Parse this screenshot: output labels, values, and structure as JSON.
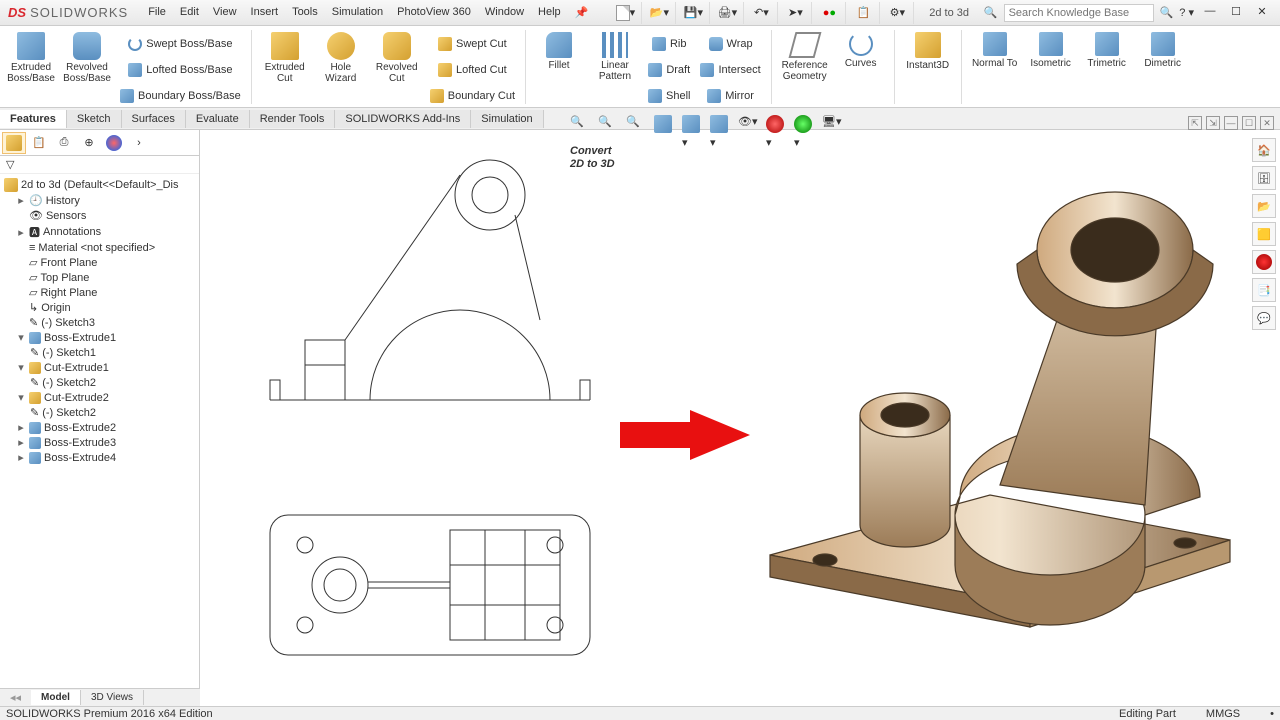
{
  "app": {
    "logo_ds": "DS",
    "logo_text": "SOLIDWORKS",
    "doc_title": "2d to 3d"
  },
  "menus": [
    "File",
    "Edit",
    "View",
    "Insert",
    "Tools",
    "Simulation",
    "PhotoView 360",
    "Window",
    "Help"
  ],
  "search_placeholder": "Search Knowledge Base",
  "ribbon": {
    "boss": {
      "extruded": "Extruded Boss/Base",
      "revolved": "Revolved Boss/Base",
      "swept": "Swept Boss/Base",
      "lofted": "Lofted Boss/Base",
      "boundary": "Boundary Boss/Base"
    },
    "cut": {
      "extruded": "Extruded Cut",
      "hole": "Hole Wizard",
      "revolved": "Revolved Cut",
      "swept": "Swept Cut",
      "lofted": "Lofted Cut",
      "boundary": "Boundary Cut"
    },
    "feat": {
      "fillet": "Fillet",
      "pattern": "Linear Pattern",
      "rib": "Rib",
      "draft": "Draft",
      "shell": "Shell",
      "wrap": "Wrap",
      "intersect": "Intersect",
      "mirror": "Mirror"
    },
    "ref": {
      "geom": "Reference Geometry",
      "curves": "Curves"
    },
    "instant": "Instant3D",
    "views": {
      "normal": "Normal To",
      "iso": "Isometric",
      "tri": "Trimetric",
      "di": "Dimetric"
    }
  },
  "tabs": [
    "Features",
    "Sketch",
    "Surfaces",
    "Evaluate",
    "Render Tools",
    "SOLIDWORKS Add-Ins",
    "Simulation"
  ],
  "tree": {
    "root": "2d to 3d  (Default<<Default>_Dis",
    "history": "History",
    "sensors": "Sensors",
    "annotations": "Annotations",
    "material": "Material <not specified>",
    "front": "Front Plane",
    "top": "Top Plane",
    "right": "Right Plane",
    "origin": "Origin",
    "sketch3": "(-) Sketch3",
    "bossex1": "Boss-Extrude1",
    "sketch1": "(-) Sketch1",
    "cutex1": "Cut-Extrude1",
    "sketch2a": "(-) Sketch2",
    "cutex2": "Cut-Extrude2",
    "sketch2b": "(-) Sketch2",
    "bossex2": "Boss-Extrude2",
    "bossex3": "Boss-Extrude3",
    "bossex4": "Boss-Extrude4"
  },
  "overlay": {
    "line1": "Convert",
    "line2": "2D to 3D"
  },
  "bottom_tabs": [
    "Model",
    "3D Views"
  ],
  "status": {
    "left": "SOLIDWORKS Premium 2016 x64 Edition",
    "editing": "Editing Part",
    "units": "MMGS"
  }
}
